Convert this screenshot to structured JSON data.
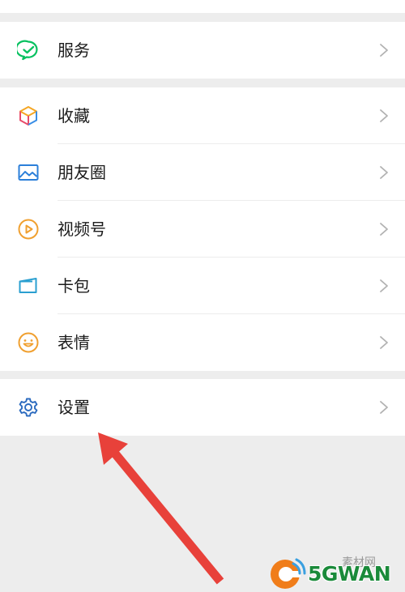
{
  "menu": {
    "service": {
      "label": "服务",
      "icon": "wechat-pay-icon",
      "color": "#07c160"
    },
    "items": [
      {
        "label": "收藏",
        "icon": "cube-icon"
      },
      {
        "label": "朋友圈",
        "icon": "photo-icon"
      },
      {
        "label": "视频号",
        "icon": "play-icon"
      },
      {
        "label": "卡包",
        "icon": "card-wallet-icon"
      },
      {
        "label": "表情",
        "icon": "smiley-icon"
      }
    ],
    "settings": {
      "label": "设置",
      "icon": "gear-icon"
    }
  },
  "annotation": {
    "type": "red-arrow",
    "color": "#e8413a",
    "points_to": "设置"
  },
  "watermark": {
    "text": "5GWAN",
    "top_text": "素材网"
  }
}
